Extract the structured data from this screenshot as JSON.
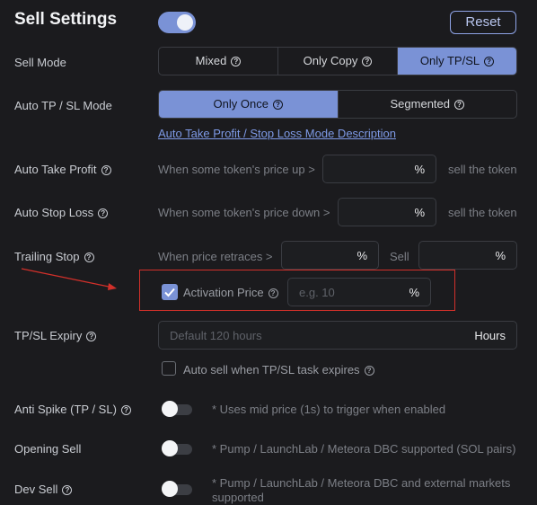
{
  "header": {
    "title": "Sell Settings",
    "reset_label": "Reset",
    "main_toggle_on": true
  },
  "sell_mode": {
    "label": "Sell Mode",
    "options": [
      "Mixed",
      "Only Copy",
      "Only TP/SL"
    ],
    "selected": "Only TP/SL"
  },
  "auto_mode": {
    "label": "Auto TP / SL Mode",
    "options": [
      "Only Once",
      "Segmented"
    ],
    "selected": "Only Once",
    "description_link": "Auto Take Profit / Stop Loss Mode Description"
  },
  "take_profit": {
    "label": "Auto Take Profit",
    "prefix": "When some token's price up >",
    "unit": "%",
    "suffix": "sell the token"
  },
  "stop_loss": {
    "label": "Auto Stop Loss",
    "prefix": "When some token's price down >",
    "unit": "%",
    "suffix": "sell the token"
  },
  "trailing": {
    "label": "Trailing Stop",
    "prefix": "When price retraces >",
    "unit": "%",
    "sell_label": "Sell",
    "sell_unit": "%"
  },
  "activation": {
    "label": "Activation Price",
    "checked": true,
    "placeholder": "e.g. 10",
    "unit": "%"
  },
  "expiry": {
    "label": "TP/SL Expiry",
    "placeholder": "Default 120 hours",
    "unit": "Hours",
    "auto_sell_label": "Auto sell when TP/SL task expires",
    "auto_sell_checked": false
  },
  "anti_spike": {
    "label": "Anti Spike (TP / SL)",
    "note": "* Uses mid price (1s) to trigger when enabled",
    "enabled": false
  },
  "opening_sell": {
    "label": "Opening Sell",
    "note": "* Pump / LaunchLab / Meteora DBC supported (SOL pairs)",
    "enabled": false
  },
  "dev_sell": {
    "label": "Dev Sell",
    "note_line1": "* Pump / LaunchLab / Meteora DBC and external markets",
    "note_line2": "supported",
    "enabled": false
  },
  "colors": {
    "accent": "#7a92d6",
    "annotation": "#d2302a",
    "background": "#1b1b1e"
  }
}
